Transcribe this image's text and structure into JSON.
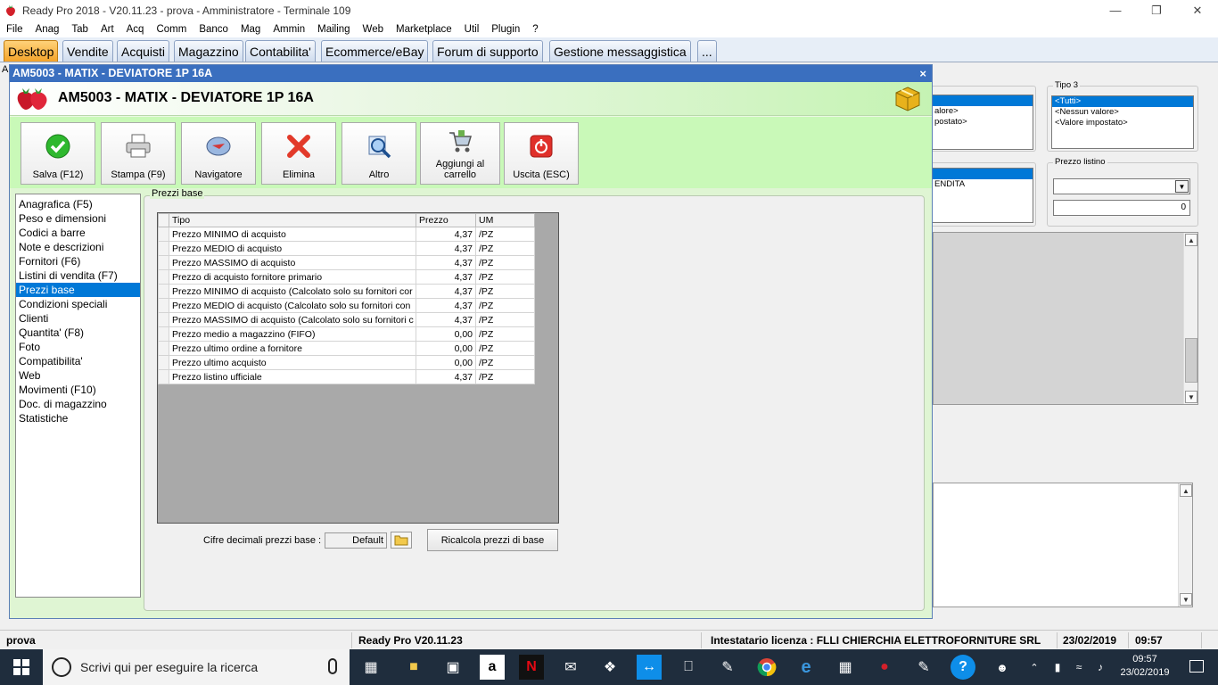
{
  "app": {
    "title": "Ready Pro 2018 - V20.11.23 - prova - Amministratore - Terminale 109"
  },
  "menu": [
    "File",
    "Anag",
    "Tab",
    "Art",
    "Acq",
    "Comm",
    "Banco",
    "Mag",
    "Ammin",
    "Mailing",
    "Web",
    "Marketplace",
    "Util",
    "Plugin",
    "?"
  ],
  "tabs": [
    "Desktop",
    "Vendite",
    "Acquisti",
    "Magazzino",
    "Contabilita'",
    "Ecommerce/eBay",
    "Forum di supporto",
    "Gestione messaggistica",
    "..."
  ],
  "right_panel": {
    "tipo3_legend": "Tipo 3",
    "tipo3_items": [
      "<Tutti>",
      "<Nessun valore>",
      "<Valore impostato>"
    ],
    "partial_items": [
      "alore>",
      "postato>"
    ],
    "partial_list2": "ENDITA",
    "prezzo_listino_legend": "Prezzo listino",
    "prezzo_listino_value": "0"
  },
  "window": {
    "title": "AM5003 - MATIX - DEVIATORE 1P 16A",
    "heading": "AM5003 - MATIX - DEVIATORE 1P 16A",
    "close": "×"
  },
  "toolbar": {
    "salva": "Salva (F12)",
    "stampa": "Stampa (F9)",
    "navigatore": "Navigatore",
    "elimina": "Elimina",
    "altro": "Altro",
    "aggiungi_line1": "Aggiungi al",
    "aggiungi_line2": "carrello",
    "uscita": "Uscita (ESC)"
  },
  "nav": {
    "items": [
      "Anagrafica (F5)",
      "Peso e dimensioni",
      "Codici a barre",
      "Note e descrizioni",
      "Fornitori (F6)",
      "Listini di vendita (F7)",
      "Prezzi base",
      "Condizioni speciali",
      "Clienti",
      "Quantita' (F8)",
      "Foto",
      "Compatibilita'",
      "Web",
      "Movimenti (F10)",
      "Doc. di magazzino",
      "Statistiche"
    ],
    "selected_index": 6
  },
  "prezzi_base": {
    "legend": "Prezzi base",
    "columns": [
      "Tipo",
      "Prezzo",
      "UM"
    ],
    "rows": [
      [
        "Prezzo MINIMO di acquisto",
        "4,37",
        "/PZ"
      ],
      [
        "Prezzo MEDIO di acquisto",
        "4,37",
        "/PZ"
      ],
      [
        "Prezzo MASSIMO di acquisto",
        "4,37",
        "/PZ"
      ],
      [
        "Prezzo di acquisto fornitore primario",
        "4,37",
        "/PZ"
      ],
      [
        "Prezzo MINIMO di acquisto (Calcolato solo su fornitori cor",
        "4,37",
        "/PZ"
      ],
      [
        "Prezzo MEDIO di acquisto (Calcolato solo su fornitori con",
        "4,37",
        "/PZ"
      ],
      [
        "Prezzo MASSIMO di acquisto (Calcolato solo su fornitori c",
        "4,37",
        "/PZ"
      ],
      [
        "Prezzo medio a magazzino (FIFO)",
        "0,00",
        "/PZ"
      ],
      [
        "Prezzo ultimo ordine a fornitore",
        "0,00",
        "/PZ"
      ],
      [
        "Prezzo ultimo acquisto",
        "0,00",
        "/PZ"
      ],
      [
        "Prezzo listino ufficiale",
        "4,37",
        "/PZ"
      ]
    ],
    "decimali_label": "Cifre decimali prezzi base :",
    "decimali_value": "Default",
    "ricalcola": "Ricalcola prezzi di base"
  },
  "status": {
    "db": "prova",
    "version": "Ready Pro V20.11.23",
    "license": "Intestatario licenza : FLLI CHIERCHIA ELETTROFORNITURE SRL",
    "date": "23/02/2019",
    "time": "09:57"
  },
  "taskbar": {
    "search_placeholder": "Scrivi qui per eseguire la ricerca",
    "clock_time": "09:57",
    "clock_date": "23/02/2019"
  },
  "colors": {
    "accent_tab": "#f3a32a",
    "window_title": "#3a6fbf",
    "toolbar_bg": "#c9f9b8",
    "selection": "#0078d7"
  }
}
